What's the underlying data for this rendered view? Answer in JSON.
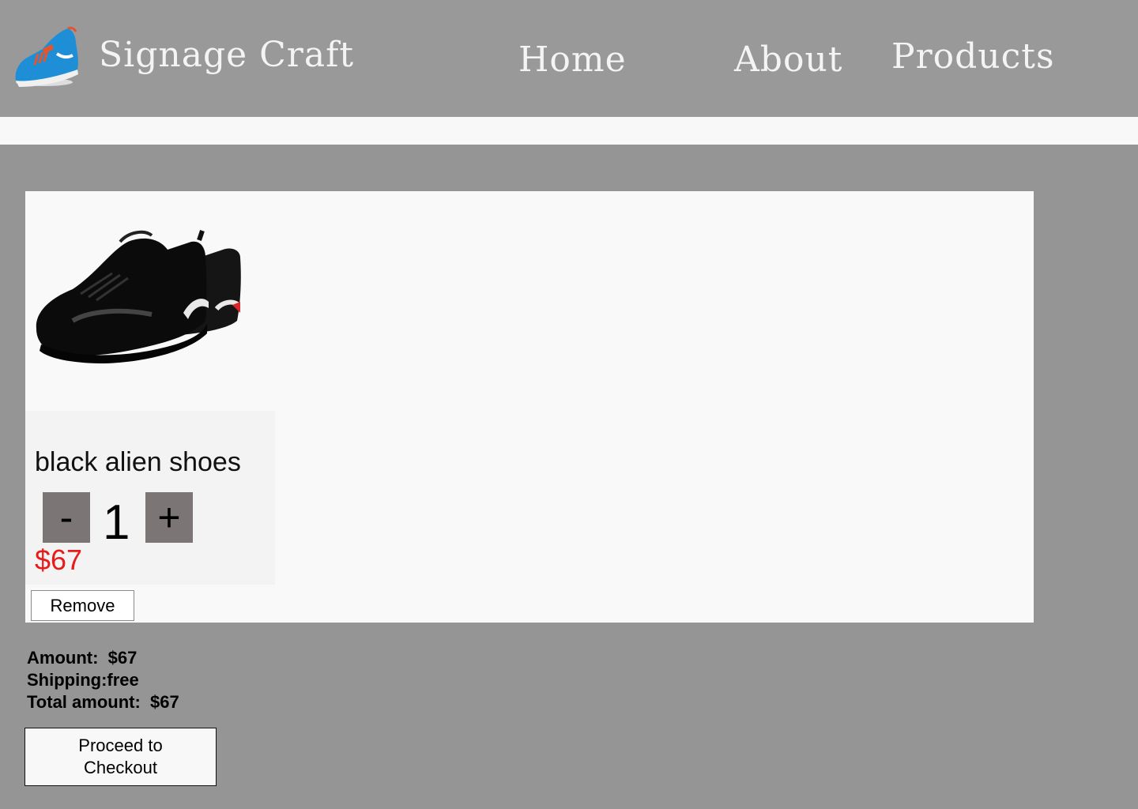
{
  "header": {
    "brand": "Signage Craft",
    "logo_icon": "running-shoe-logo",
    "nav": {
      "home": "Home",
      "about": "About",
      "products": "Products"
    }
  },
  "cart": {
    "items": [
      {
        "name": "black alien shoes",
        "image_icon": "black-sneaker-image",
        "quantity": "1",
        "decrement_label": "-",
        "increment_label": "+",
        "price": "$67",
        "remove_label": "Remove"
      }
    ]
  },
  "summary": {
    "amount": "Amount:  $67",
    "shipping": "Shipping:free",
    "total": "Total amount:  $67"
  },
  "checkout": {
    "label": "Proceed to Checkout"
  },
  "colors": {
    "background": "#959595",
    "header": "#999999",
    "price": "#e81b1b",
    "qty_button": "#7b7675"
  }
}
